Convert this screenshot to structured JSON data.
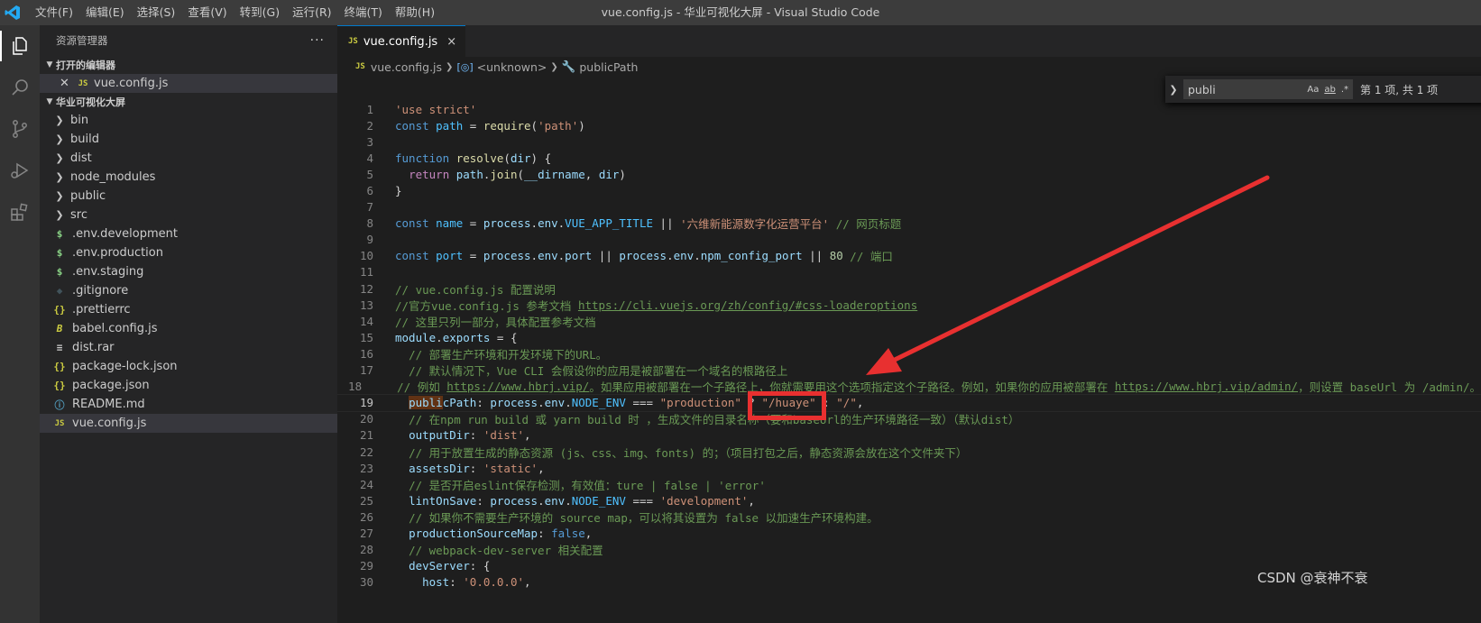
{
  "titlebar": {
    "menu": [
      "文件(F)",
      "编辑(E)",
      "选择(S)",
      "查看(V)",
      "转到(G)",
      "运行(R)",
      "终端(T)",
      "帮助(H)"
    ],
    "window_title": "vue.config.js - 华业可视化大屏 - Visual Studio Code"
  },
  "activity_bar": {
    "icons": [
      "files-icon",
      "search-icon",
      "source-control-icon",
      "run-debug-icon",
      "extensions-icon"
    ]
  },
  "sidebar": {
    "title": "资源管理器",
    "more": "···",
    "open_editors_label": "打开的编辑器",
    "open_editors": [
      {
        "icon": "JS",
        "label": "vue.config.js"
      }
    ],
    "project_label": "华业可视化大屏",
    "items": [
      {
        "kind": "folder",
        "label": "bin"
      },
      {
        "kind": "folder",
        "label": "build"
      },
      {
        "kind": "folder",
        "label": "dist"
      },
      {
        "kind": "folder",
        "label": "node_modules"
      },
      {
        "kind": "folder",
        "label": "public"
      },
      {
        "kind": "folder",
        "label": "src"
      },
      {
        "kind": "env",
        "icon": "$",
        "label": ".env.development"
      },
      {
        "kind": "env",
        "icon": "$",
        "label": ".env.production"
      },
      {
        "kind": "env",
        "icon": "$",
        "label": ".env.staging"
      },
      {
        "kind": "git",
        "icon": "◆",
        "label": ".gitignore"
      },
      {
        "kind": "json",
        "icon": "{}",
        "label": ".prettierrc"
      },
      {
        "kind": "babel",
        "icon": "B",
        "label": "babel.config.js"
      },
      {
        "kind": "rar",
        "icon": "≡",
        "label": "dist.rar"
      },
      {
        "kind": "json",
        "icon": "{}",
        "label": "package-lock.json"
      },
      {
        "kind": "json",
        "icon": "{}",
        "label": "package.json"
      },
      {
        "kind": "info",
        "icon": "ⓘ",
        "label": "README.md"
      },
      {
        "kind": "js",
        "icon": "JS",
        "label": "vue.config.js",
        "selected": true
      }
    ]
  },
  "editor": {
    "tab": {
      "icon": "JS",
      "label": "vue.config.js",
      "close": "×"
    },
    "breadcrumb": {
      "icon": "JS",
      "file": "vue.config.js",
      "obj": "<unknown>",
      "prop": "publicPath"
    },
    "find": {
      "value": "publi",
      "opt_case": "Aa",
      "opt_word": "ab",
      "opt_regex": ".*",
      "count": "第 1 项, 共 1 项"
    },
    "current_line": 19,
    "lines": [
      [
        [
          "str",
          "'use strict'"
        ]
      ],
      [
        [
          "kw",
          "const "
        ],
        [
          "cst",
          "path"
        ],
        [
          "txt",
          " = "
        ],
        [
          "fn",
          "require"
        ],
        [
          "txt",
          "("
        ],
        [
          "str",
          "'path'"
        ],
        [
          "txt",
          ")"
        ]
      ],
      [],
      [
        [
          "kw",
          "function "
        ],
        [
          "fn",
          "resolve"
        ],
        [
          "txt",
          "("
        ],
        [
          "var",
          "dir"
        ],
        [
          "txt",
          ") {"
        ]
      ],
      [
        [
          "txt",
          "  "
        ],
        [
          "ctl",
          "return "
        ],
        [
          "var",
          "path"
        ],
        [
          "txt",
          "."
        ],
        [
          "fn",
          "join"
        ],
        [
          "txt",
          "("
        ],
        [
          "var",
          "__dirname"
        ],
        [
          "txt",
          ", "
        ],
        [
          "var",
          "dir"
        ],
        [
          "txt",
          ")"
        ]
      ],
      [
        [
          "txt",
          "}"
        ]
      ],
      [],
      [
        [
          "kw",
          "const "
        ],
        [
          "cst",
          "name"
        ],
        [
          "txt",
          " = "
        ],
        [
          "var",
          "process"
        ],
        [
          "txt",
          "."
        ],
        [
          "var",
          "env"
        ],
        [
          "txt",
          "."
        ],
        [
          "cst",
          "VUE_APP_TITLE"
        ],
        [
          "txt",
          " || "
        ],
        [
          "str",
          "'六维新能源数字化运营平台'"
        ],
        [
          "cm",
          " // 网页标题"
        ]
      ],
      [],
      [
        [
          "kw",
          "const "
        ],
        [
          "cst",
          "port"
        ],
        [
          "txt",
          " = "
        ],
        [
          "var",
          "process"
        ],
        [
          "txt",
          "."
        ],
        [
          "var",
          "env"
        ],
        [
          "txt",
          "."
        ],
        [
          "var",
          "port"
        ],
        [
          "txt",
          " || "
        ],
        [
          "var",
          "process"
        ],
        [
          "txt",
          "."
        ],
        [
          "var",
          "env"
        ],
        [
          "txt",
          "."
        ],
        [
          "var",
          "npm_config_port"
        ],
        [
          "txt",
          " || "
        ],
        [
          "num",
          "80"
        ],
        [
          "cm",
          " // 端口"
        ]
      ],
      [],
      [
        [
          "cm",
          "// vue.config.js 配置说明"
        ]
      ],
      [
        [
          "cm",
          "//官方vue.config.js 参考文档 "
        ],
        [
          "cm ul",
          "https://cli.vuejs.org/zh/config/#css-loaderoptions"
        ]
      ],
      [
        [
          "cm",
          "// 这里只列一部分，具体配置参考文档"
        ]
      ],
      [
        [
          "var",
          "module"
        ],
        [
          "txt",
          "."
        ],
        [
          "var",
          "exports"
        ],
        [
          "txt",
          " = {"
        ]
      ],
      [
        [
          "txt",
          "  "
        ],
        [
          "cm",
          "// 部署生产环境和开发环境下的URL。"
        ]
      ],
      [
        [
          "txt",
          "  "
        ],
        [
          "cm",
          "// 默认情况下，Vue CLI 会假设你的应用是被部署在一个域名的根路径上"
        ]
      ],
      [
        [
          "txt",
          "  "
        ],
        [
          "cm",
          "// 例如 "
        ],
        [
          "cm ul",
          "https://www.hbrj.vip/"
        ],
        [
          "cm",
          "。如果应用被部署在一个子路径上，你就需要用这个选项指定这个子路径。例如，如果你的应用被部署在 "
        ],
        [
          "cm ul",
          "https://www.hbrj.vip/admin/"
        ],
        [
          "cm",
          "，则设置 baseUrl 为 /admin/。"
        ]
      ],
      [
        [
          "txt",
          "  "
        ],
        [
          "var hl",
          "publi"
        ],
        [
          "var",
          "cPath"
        ],
        [
          "txt",
          ": "
        ],
        [
          "var",
          "process"
        ],
        [
          "txt",
          "."
        ],
        [
          "var",
          "env"
        ],
        [
          "txt",
          "."
        ],
        [
          "cst",
          "NODE_ENV"
        ],
        [
          "txt",
          " === "
        ],
        [
          "str",
          "\"production\""
        ],
        [
          "txt",
          " ? "
        ],
        [
          "str",
          "\"/huaye\""
        ],
        [
          "txt",
          " : "
        ],
        [
          "str",
          "\"/\""
        ],
        [
          "txt",
          ","
        ]
      ],
      [
        [
          "txt",
          "  "
        ],
        [
          "cm",
          "// 在npm run build 或 yarn build 时 ，生成文件的目录名称（要和baseUrl的生产环境路径一致）（默认dist）"
        ]
      ],
      [
        [
          "txt",
          "  "
        ],
        [
          "var",
          "outputDir"
        ],
        [
          "txt",
          ": "
        ],
        [
          "str",
          "'dist'"
        ],
        [
          "txt",
          ","
        ]
      ],
      [
        [
          "txt",
          "  "
        ],
        [
          "cm",
          "// 用于放置生成的静态资源 (js、css、img、fonts) 的；（项目打包之后，静态资源会放在这个文件夹下）"
        ]
      ],
      [
        [
          "txt",
          "  "
        ],
        [
          "var",
          "assetsDir"
        ],
        [
          "txt",
          ": "
        ],
        [
          "str",
          "'static'"
        ],
        [
          "txt",
          ","
        ]
      ],
      [
        [
          "txt",
          "  "
        ],
        [
          "cm",
          "// 是否开启eslint保存检测，有效值：ture | false | 'error'"
        ]
      ],
      [
        [
          "txt",
          "  "
        ],
        [
          "var",
          "lintOnSave"
        ],
        [
          "txt",
          ": "
        ],
        [
          "var",
          "process"
        ],
        [
          "txt",
          "."
        ],
        [
          "var",
          "env"
        ],
        [
          "txt",
          "."
        ],
        [
          "cst",
          "NODE_ENV"
        ],
        [
          "txt",
          " === "
        ],
        [
          "str",
          "'development'"
        ],
        [
          "txt",
          ","
        ]
      ],
      [
        [
          "txt",
          "  "
        ],
        [
          "cm",
          "// 如果你不需要生产环境的 source map，可以将其设置为 false 以加速生产环境构建。"
        ]
      ],
      [
        [
          "txt",
          "  "
        ],
        [
          "var",
          "productionSourceMap"
        ],
        [
          "txt",
          ": "
        ],
        [
          "kw",
          "false"
        ],
        [
          "txt",
          ","
        ]
      ],
      [
        [
          "txt",
          "  "
        ],
        [
          "cm",
          "// webpack-dev-server 相关配置"
        ]
      ],
      [
        [
          "txt",
          "  "
        ],
        [
          "var",
          "devServer"
        ],
        [
          "txt",
          ": {"
        ]
      ],
      [
        [
          "txt",
          "    "
        ],
        [
          "var",
          "host"
        ],
        [
          "txt",
          ": "
        ],
        [
          "str",
          "'0.0.0.0'"
        ],
        [
          "txt",
          ","
        ]
      ]
    ]
  },
  "watermark": "CSDN @衰神不衰",
  "colors": {
    "accent": "#007acc",
    "annotation": "#e83030"
  }
}
